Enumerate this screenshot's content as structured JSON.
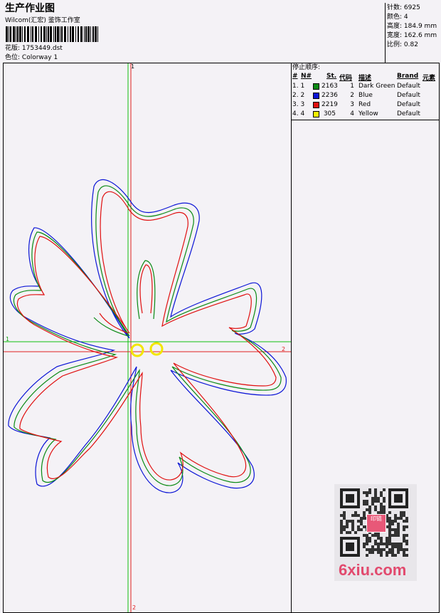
{
  "header": {
    "title": "生产作业图",
    "company": "Wilcom(汇宏) 鉴饰工作室",
    "design_label": "花版:",
    "design_value": "1753449.dst",
    "colorway_label": "色位:",
    "colorway_value": "Colorway 1"
  },
  "stats": {
    "stitches_label": "针数:",
    "stitches_value": "6925",
    "colors_label": "颜色:",
    "colors_value": "4",
    "height_label": "高度:",
    "height_value": "184.9 mm",
    "width_label": "宽度:",
    "width_value": "162.6 mm",
    "scale_label": "比例:",
    "scale_value": "0.82"
  },
  "stop_sequence": {
    "title": "停止顺序:",
    "columns": [
      "#",
      "N#",
      "St.",
      "代码",
      "描述",
      "Brand",
      "元素"
    ],
    "rows": [
      {
        "n": "1. 1",
        "color": "#0a8a14",
        "st": "2163",
        "code": "1",
        "desc": "Dark Green",
        "brand": "Default"
      },
      {
        "n": "2. 2",
        "color": "#0b14d6",
        "st": "2236",
        "code": "2",
        "desc": "Blue",
        "brand": "Default"
      },
      {
        "n": "3. 3",
        "color": "#e01010",
        "st": "2219",
        "code": "3",
        "desc": "Red",
        "brand": "Default"
      },
      {
        "n": "4. 4",
        "color": "#f2f200",
        "st": "305",
        "code": "4",
        "desc": "Yellow",
        "brand": "Default"
      }
    ]
  },
  "axes": {
    "v_top": "1",
    "v_bottom": "2",
    "h_left": "1",
    "h_right": "2"
  },
  "watermark": {
    "site": "6xiu.com",
    "stamp": "印链"
  }
}
